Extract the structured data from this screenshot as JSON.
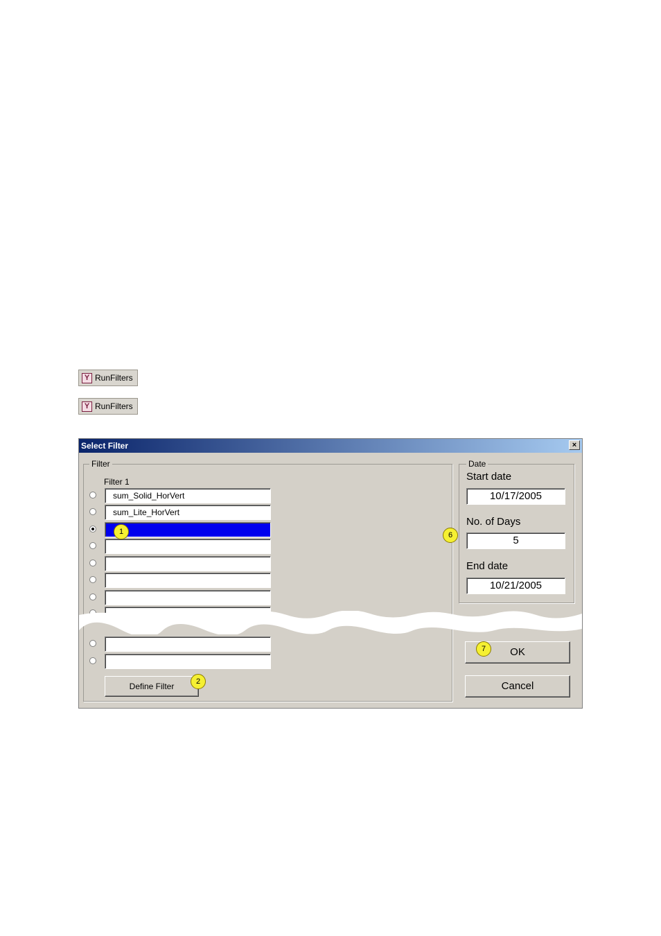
{
  "toolbar_buttons": [
    {
      "label": "RunFilters",
      "icon": "filter-funnel-icon"
    },
    {
      "label": "RunFilters",
      "icon": "filter-funnel-icon"
    }
  ],
  "dialog": {
    "title": "Select Filter",
    "close_glyph": "×",
    "filter_group": {
      "legend": "Filter",
      "column_label": "Filter 1",
      "rows": [
        {
          "value": "sum_Solid_HorVert",
          "selected": false
        },
        {
          "value": "sum_Lite_HorVert",
          "selected": false
        },
        {
          "value": "",
          "selected": true
        },
        {
          "value": "",
          "selected": false
        },
        {
          "value": "",
          "selected": false
        },
        {
          "value": "",
          "selected": false
        },
        {
          "value": "",
          "selected": false
        },
        {
          "value": "",
          "selected": false
        },
        {
          "value": "",
          "selected": false
        },
        {
          "value": "",
          "selected": false
        }
      ],
      "define_button": "Define Filter"
    },
    "date_group": {
      "legend": "Date",
      "start_label": "Start date",
      "start_value": "10/17/2005",
      "days_label": "No. of Days",
      "days_value": "5",
      "end_label": "End date",
      "end_value": "10/21/2005"
    },
    "ok_button": "OK",
    "cancel_button": "Cancel"
  },
  "callouts": [
    "1",
    "2",
    "6",
    "7"
  ],
  "colors": {
    "title_gradient_start": "#0a246a",
    "title_gradient_end": "#a6caf0",
    "dialog_face": "#d4d0c8",
    "selection": "#0000ee",
    "callout": "#f5f032"
  }
}
